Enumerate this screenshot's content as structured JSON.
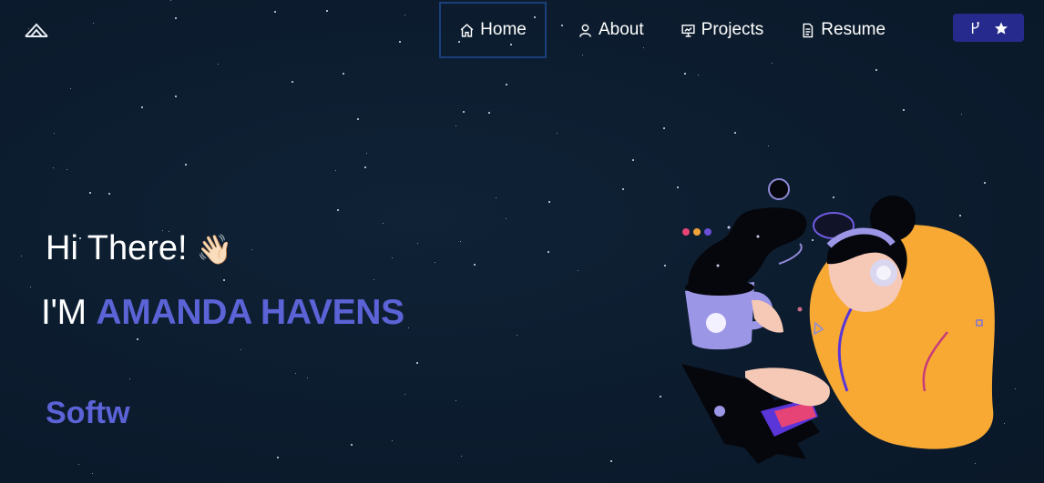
{
  "logo": {
    "icon": "logo-mark"
  },
  "nav": {
    "items": [
      {
        "label": "Home",
        "icon": "home-icon",
        "active": true
      },
      {
        "label": "About",
        "icon": "user-icon"
      },
      {
        "label": "Projects",
        "icon": "presentation-icon"
      },
      {
        "label": "Resume",
        "icon": "document-icon"
      }
    ],
    "github_button": {
      "icons": [
        "git-fork-icon",
        "star-icon"
      ],
      "color": "#262a8c"
    }
  },
  "hero": {
    "greeting": "Hi There!",
    "wave_emoji": "👋🏻",
    "name_prefix": "I'M",
    "name": "AMANDA HAVENS",
    "typed_role": "Softw"
  },
  "colors": {
    "background": "#0c1c2e",
    "accent": "#5b63d6",
    "active_border": "#1a3f7a"
  }
}
